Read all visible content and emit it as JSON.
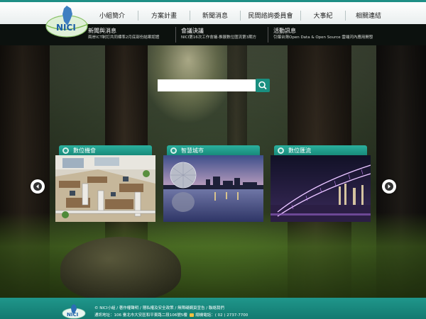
{
  "header": {
    "logo_text": "NICI",
    "nav": [
      "小組簡介",
      "方案計畫",
      "新聞消息",
      "民間諮詢委員會",
      "大事紀",
      "相關連結"
    ]
  },
  "news": [
    {
      "title": "新聞與消息",
      "summary": "兩岸ICT制訂共同標準2月底部份結案認證"
    },
    {
      "title": "會議決議",
      "summary": "NICI第16次工作會議-推展數位匯流第3期方"
    },
    {
      "title": "活動訊息",
      "summary": "引爆台灣Open Data & Open Source 雲端河內應用開發"
    }
  ],
  "search": {
    "placeholder": "",
    "button_icon": "search-icon"
  },
  "cards": [
    {
      "label": "數位機會",
      "image": "office"
    },
    {
      "label": "智慧城市",
      "image": "city"
    },
    {
      "label": "數位匯流",
      "image": "bridge"
    }
  ],
  "footer": {
    "line1": "© NICI小組 / 著作權聲明 / 隱私權及安全政策 / 無障礙網頁宣告 / 聯絡我們",
    "line2_prefix": "通訊地址：106 臺北市大安區和平東路二段106號5樓",
    "line2_suffix": "總機電話：( 02 ) 2737-7700"
  },
  "colors": {
    "accent": "#1a8f80",
    "header_bg": "#ffffff",
    "news_bg": "#0a0e0c"
  }
}
